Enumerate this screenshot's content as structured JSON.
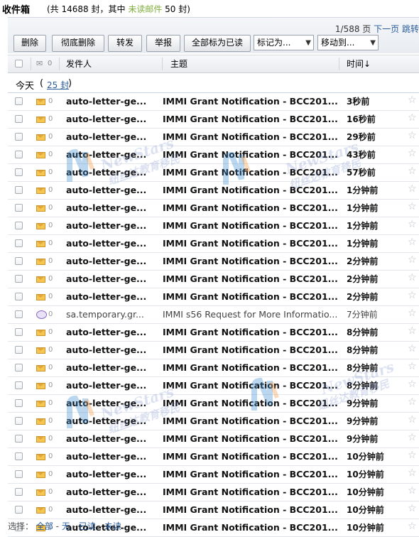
{
  "title": {
    "folder": "收件箱",
    "stats_prefix": "(共 14688 封，其中 ",
    "unread_label": "未读邮件",
    "stats_suffix": " 50 封)"
  },
  "pager": {
    "page": "1/588 页",
    "next": "下一页",
    "jump": "跳转"
  },
  "toolbar": {
    "delete": "删除",
    "delete_permanent": "彻底删除",
    "forward": "转发",
    "report": "举报",
    "mark_all_read": "全部标为已读",
    "mark_as": "标记为...",
    "move_to": "移动到..."
  },
  "columns": {
    "sender": "发件人",
    "subject": "主题",
    "time": "时间↓"
  },
  "group": {
    "label": "今天",
    "count": "25 封"
  },
  "rows": [
    {
      "sender": "auto-letter-ge...",
      "subject": "IMMI Grant Notification - BCC201...",
      "time": "3秒前"
    },
    {
      "sender": "auto-letter-ge...",
      "subject": "IMMI Grant Notification - BCC201...",
      "time": "16秒前"
    },
    {
      "sender": "auto-letter-ge...",
      "subject": "IMMI Grant Notification - BCC201...",
      "time": "29秒前"
    },
    {
      "sender": "auto-letter-ge...",
      "subject": "IMMI Grant Notification - BCC201...",
      "time": "43秒前"
    },
    {
      "sender": "auto-letter-ge...",
      "subject": "IMMI Grant Notification - BCC201...",
      "time": "57秒前"
    },
    {
      "sender": "auto-letter-ge...",
      "subject": "IMMI Grant Notification - BCC201...",
      "time": "1分钟前"
    },
    {
      "sender": "auto-letter-ge...",
      "subject": "IMMI Grant Notification - BCC201...",
      "time": "1分钟前"
    },
    {
      "sender": "auto-letter-ge...",
      "subject": "IMMI Grant Notification - BCC201...",
      "time": "1分钟前"
    },
    {
      "sender": "auto-letter-ge...",
      "subject": "IMMI Grant Notification - BCC201...",
      "time": "1分钟前"
    },
    {
      "sender": "auto-letter-ge...",
      "subject": "IMMI Grant Notification - BCC201...",
      "time": "2分钟前"
    },
    {
      "sender": "auto-letter-ge...",
      "subject": "IMMI Grant Notification - BCC201...",
      "time": "2分钟前"
    },
    {
      "sender": "auto-letter-ge...",
      "subject": "IMMI Grant Notification - BCC201...",
      "time": "2分钟前"
    },
    {
      "sender": "sa.temporary.gr...",
      "subject": "IMMI s56 Request for More Informatio...",
      "time": "7分钟前",
      "read": true
    },
    {
      "sender": "auto-letter-ge...",
      "subject": "IMMI Grant Notification - BCC201...",
      "time": "8分钟前"
    },
    {
      "sender": "auto-letter-ge...",
      "subject": "IMMI Grant Notification - BCC201...",
      "time": "8分钟前"
    },
    {
      "sender": "auto-letter-ge...",
      "subject": "IMMI Grant Notification - BCC201...",
      "time": "8分钟前"
    },
    {
      "sender": "auto-letter-ge...",
      "subject": "IMMI Grant Notification - BCC201...",
      "time": "8分钟前"
    },
    {
      "sender": "auto-letter-ge...",
      "subject": "IMMI Grant Notification - BCC201...",
      "time": "9分钟前"
    },
    {
      "sender": "auto-letter-ge...",
      "subject": "IMMI Grant Notification - BCC201...",
      "time": "9分钟前"
    },
    {
      "sender": "auto-letter-ge...",
      "subject": "IMMI Grant Notification - BCC201...",
      "time": "9分钟前"
    },
    {
      "sender": "auto-letter-ge...",
      "subject": "IMMI Grant Notification - BCC201...",
      "time": "10分钟前"
    },
    {
      "sender": "auto-letter-ge...",
      "subject": "IMMI Grant Notification - BCC201...",
      "time": "10分钟前"
    },
    {
      "sender": "auto-letter-ge...",
      "subject": "IMMI Grant Notification - BCC201...",
      "time": "10分钟前"
    },
    {
      "sender": "auto-letter-ge...",
      "subject": "IMMI Grant Notification - BCC201...",
      "time": "10分钟前"
    },
    {
      "sender": "auto-letter-ge...",
      "subject": "IMMI Grant Notification - BCC201...",
      "time": "10分钟前"
    }
  ],
  "footer": {
    "label": "选择：",
    "all": "全部",
    "none": "无",
    "read": "已读",
    "unread": "未读",
    "sep": " - "
  },
  "watermark": {
    "brand": "NewStars",
    "cn": "纽丝达教育移民"
  },
  "colors": {
    "unread_green": "#7fae3b",
    "link_blue": "#2a5d9a",
    "envelope_yellow": "#f7c651"
  }
}
